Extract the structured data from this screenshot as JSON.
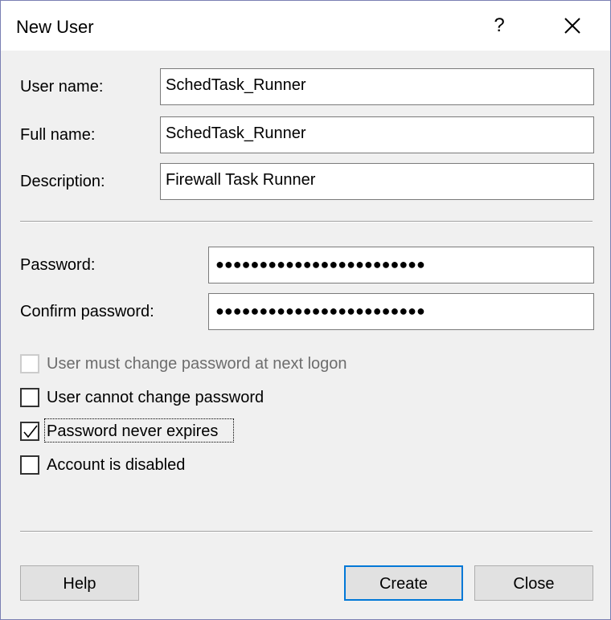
{
  "window": {
    "title": "New User",
    "help_glyph": "?",
    "close_icon": "close-icon"
  },
  "form": {
    "user_name_label": "User name:",
    "user_name_value": "SchedTask_Runner",
    "full_name_label": "Full name:",
    "full_name_value": "SchedTask_Runner",
    "description_label": "Description:",
    "description_value": "Firewall Task Runner",
    "password_label": "Password:",
    "password_value": "●●●●●●●●●●●●●●●●●●●●●●●●",
    "confirm_password_label": "Confirm password:",
    "confirm_password_value": "●●●●●●●●●●●●●●●●●●●●●●●●"
  },
  "options": [
    {
      "label": "User must change password at next logon",
      "checked": false,
      "enabled": false
    },
    {
      "label": "User cannot change password",
      "checked": false,
      "enabled": true
    },
    {
      "label": "Password never expires",
      "checked": true,
      "enabled": true
    },
    {
      "label": "Account is disabled",
      "checked": false,
      "enabled": true
    }
  ],
  "buttons": {
    "help": "Help",
    "create": "Create",
    "close": "Close"
  },
  "colors": {
    "accent": "#0078d7",
    "dialog_bg": "#f0f0f0",
    "disabled_text": "#6d6d6d"
  }
}
